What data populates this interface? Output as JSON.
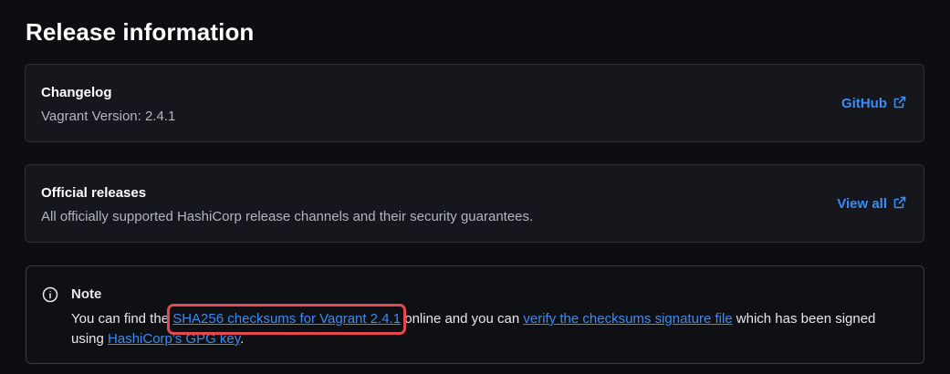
{
  "section": {
    "title": "Release information"
  },
  "changelog": {
    "title": "Changelog",
    "version_text": "Vagrant Version: 2.4.1",
    "link_label": "GitHub"
  },
  "official_releases": {
    "title": "Official releases",
    "description": "All officially supported HashiCorp release channels and their security guarantees.",
    "link_label": "View all"
  },
  "note": {
    "title": "Note",
    "text_1": "You can find the ",
    "link_checksums": "SHA256 checksums for Vagrant 2.4.1",
    "text_2": " online and you can ",
    "link_verify": "verify the checksums signature file",
    "text_3": " which has been signed using ",
    "link_gpg": "HashiCorp's GPG key",
    "text_4": "."
  },
  "icons": {
    "external_link": "external-link-icon",
    "info": "info-icon"
  },
  "colors": {
    "background": "#0d0e12",
    "card_background": "#15171c",
    "card_border": "#2e3138",
    "link": "#3b8cf5",
    "muted_text": "#b2b6bd",
    "highlight": "#e5484d"
  }
}
